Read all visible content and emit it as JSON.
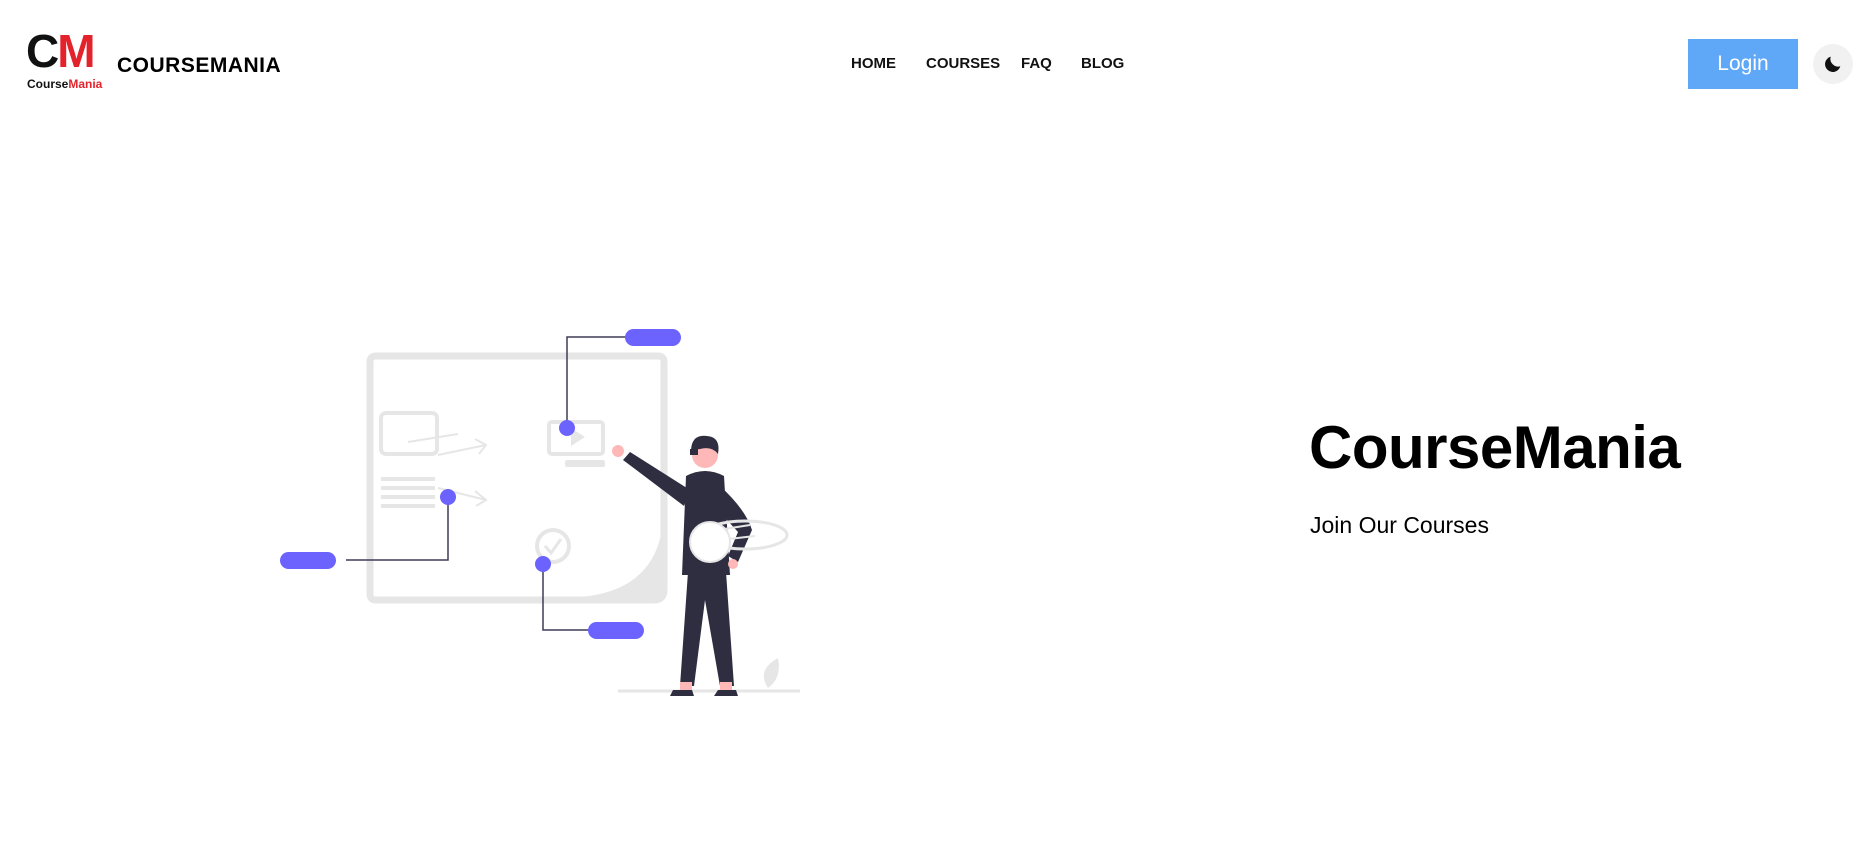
{
  "header": {
    "logo": {
      "mark_c": "C",
      "mark_m": "M",
      "sub_course": "Course",
      "sub_mania": "Mania"
    },
    "brand_name": "COURSEMANIA",
    "nav": {
      "home": "HOME",
      "courses": "COURSES",
      "faq": "FAQ",
      "blog": "BLOG"
    },
    "login_label": "Login",
    "theme_toggle_icon": "moon-icon"
  },
  "hero": {
    "title": "CourseMania",
    "subtitle": "Join Our Courses",
    "illustration": "online-learning-illustration"
  },
  "colors": {
    "logo_red": "#e3232c",
    "login_button": "#5fa7f7",
    "illustration_accent": "#6c63ff",
    "illustration_dark": "#2f2e41",
    "illustration_skin": "#ffb8b8",
    "illustration_light_gray": "#e6e6e6"
  }
}
